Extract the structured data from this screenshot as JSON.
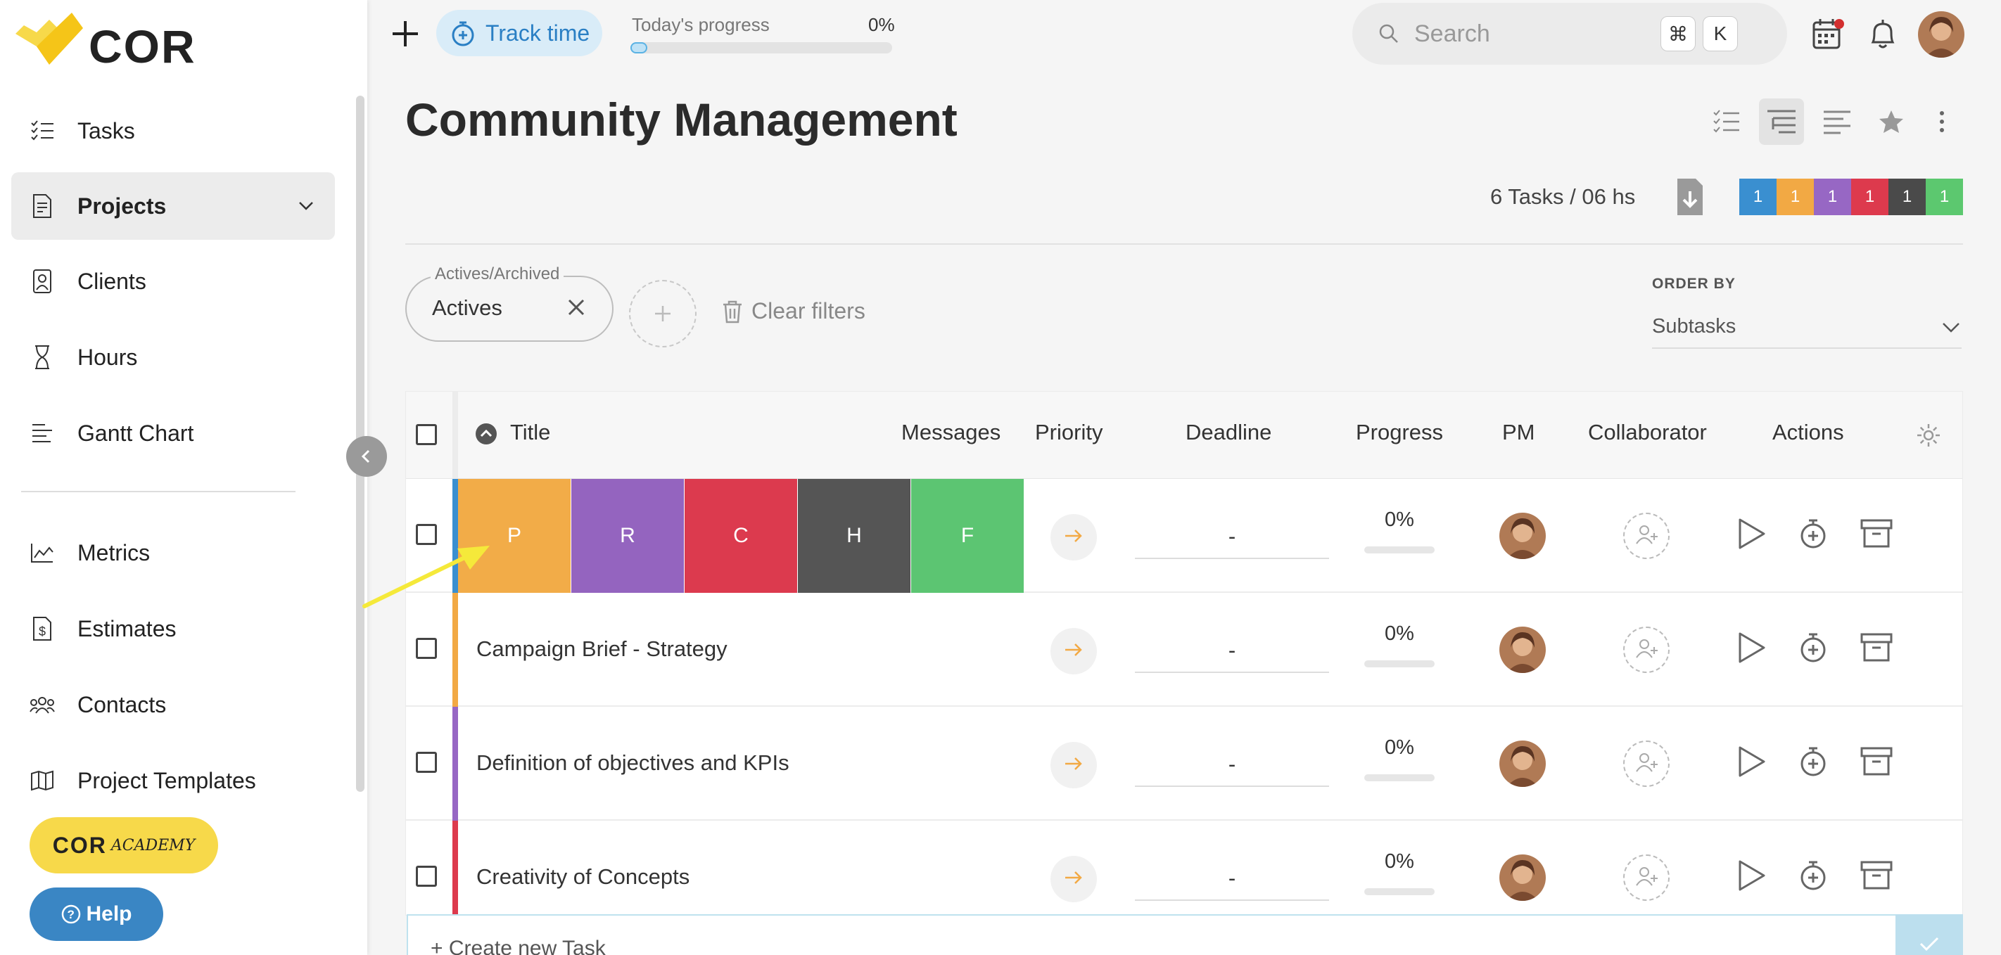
{
  "brand": {
    "logo_text": "COR"
  },
  "topbar": {
    "track_time_label": "Track time",
    "progress_label": "Today's progress",
    "progress_value": "0%",
    "progress_fraction": 0,
    "search_placeholder": "Search",
    "shortcut_keys": [
      "⌘",
      "K"
    ]
  },
  "sidebar": {
    "items": [
      {
        "label": "Tasks",
        "icon": "tasks-list-icon",
        "active": false
      },
      {
        "label": "Projects",
        "icon": "projects-doc-icon",
        "active": true
      },
      {
        "label": "Clients",
        "icon": "clients-icon",
        "active": false
      },
      {
        "label": "Hours",
        "icon": "hourglass-icon",
        "active": false
      },
      {
        "label": "Gantt Chart",
        "icon": "gantt-icon",
        "active": false
      },
      {
        "label": "Metrics",
        "icon": "metrics-chart-icon",
        "active": false
      },
      {
        "label": "Estimates",
        "icon": "estimates-dollar-icon",
        "active": false
      },
      {
        "label": "Contacts",
        "icon": "contacts-people-icon",
        "active": false
      },
      {
        "label": "Project Templates",
        "icon": "map-icon",
        "active": false
      }
    ],
    "academy": {
      "label": "COR",
      "sublabel": "ACADEMY"
    },
    "help_label": "Help"
  },
  "page": {
    "title": "Community Management",
    "tasks_summary": "6 Tasks / 06 hs",
    "color_counts": [
      {
        "color": "#3a8fd0",
        "count": "1"
      },
      {
        "color": "#f2a944",
        "count": "1"
      },
      {
        "color": "#9767c4",
        "count": "1"
      },
      {
        "color": "#dd3a4d",
        "count": "1"
      },
      {
        "color": "#4a4a4a",
        "count": "1"
      },
      {
        "color": "#5cc86f",
        "count": "1"
      }
    ]
  },
  "filters": {
    "chip_legend": "Actives/Archived",
    "chip_value": "Actives",
    "clear_label": "Clear filters",
    "order_by_label": "ORDER BY",
    "order_by_value": "Subtasks"
  },
  "table": {
    "columns": {
      "title": "Title",
      "messages": "Messages",
      "priority": "Priority",
      "deadline": "Deadline",
      "progress": "Progress",
      "pm": "PM",
      "collaborator": "Collaborator",
      "actions": "Actions"
    },
    "color_segments": [
      {
        "letter": "P",
        "color": "#f2ac48"
      },
      {
        "letter": "R",
        "color": "#9464bf"
      },
      {
        "letter": "C",
        "color": "#dc3a4e"
      },
      {
        "letter": "H",
        "color": "#555555"
      },
      {
        "letter": "F",
        "color": "#5cc572"
      }
    ],
    "rows": [
      {
        "title": "",
        "bar_color": "#3a8fd0",
        "deadline": "-",
        "progress": "0%"
      },
      {
        "title": "Campaign Brief - Strategy",
        "bar_color": "#f2a944",
        "deadline": "-",
        "progress": "0%"
      },
      {
        "title": "Definition of objectives and KPIs",
        "bar_color": "#9767c4",
        "deadline": "-",
        "progress": "0%"
      },
      {
        "title": "Creativity of Concepts",
        "bar_color": "#dd3a4d",
        "deadline": "-",
        "progress": "0%"
      }
    ],
    "create_label": "+ Create new Task"
  },
  "colors": {
    "accent": "#2a7fc4",
    "priority_arrow": "#f2a944",
    "annotation_arrow": "#f5e93a"
  }
}
